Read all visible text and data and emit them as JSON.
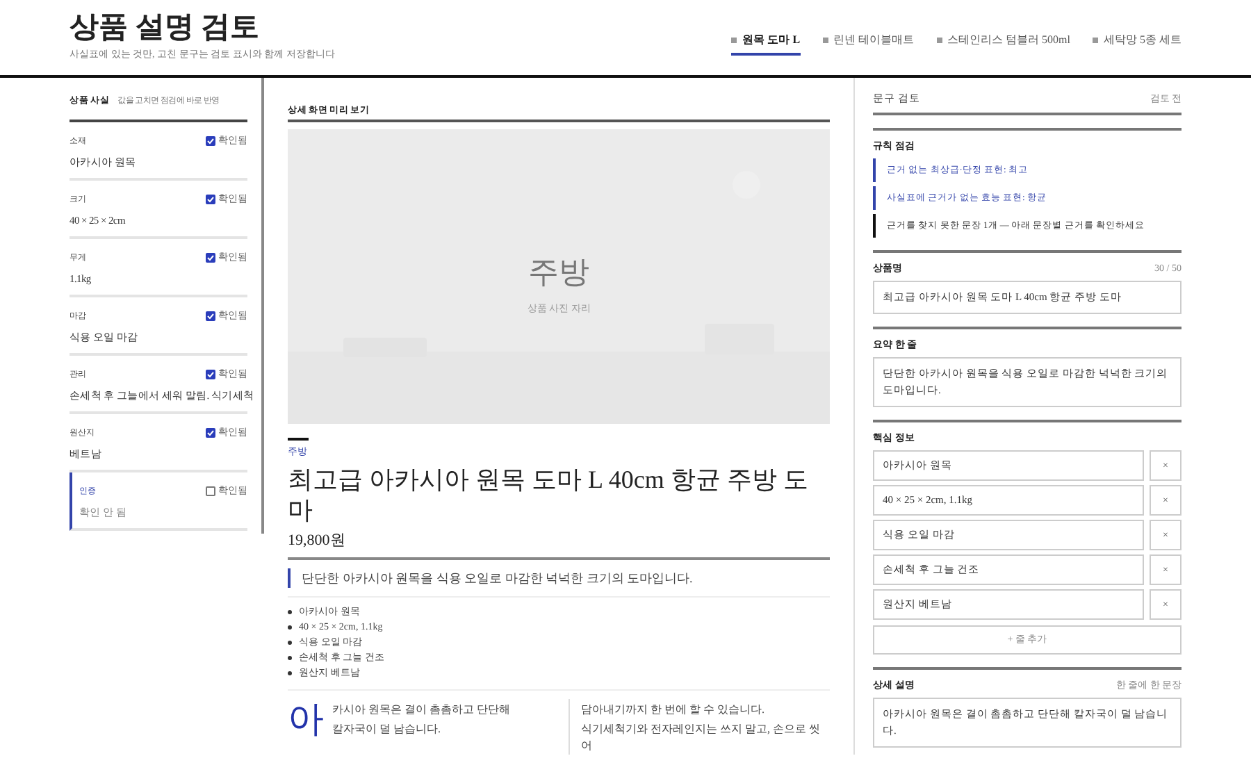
{
  "header": {
    "title": "상품 설명 검토",
    "subtitle": "사실표에 있는 것만, 고친 문구는 검토 표시와 함께 저장합니다"
  },
  "tabs": [
    {
      "label": "원목 도마 L",
      "selected": true
    },
    {
      "label": "린넨 테이블매트",
      "selected": false
    },
    {
      "label": "스테인리스 텀블러 500ml",
      "selected": false
    },
    {
      "label": "세탁망 5종 세트",
      "selected": false
    }
  ],
  "facts": {
    "title": "상품 사실",
    "hint": "값을 고치면 점검에 바로 반영",
    "fields": [
      {
        "label": "소재",
        "check_label": "확인됨",
        "checked": true,
        "value": "아카시아 원목"
      },
      {
        "label": "크기",
        "check_label": "확인됨",
        "checked": true,
        "value": "40 × 25 × 2cm"
      },
      {
        "label": "무게",
        "check_label": "확인됨",
        "checked": true,
        "value": "1.1kg"
      },
      {
        "label": "마감",
        "check_label": "확인됨",
        "checked": true,
        "value": "식용 오일 마감"
      },
      {
        "label": "관리",
        "check_label": "확인됨",
        "checked": true,
        "value": "손세척 후 그늘에서 세워 말림. 식기세척"
      },
      {
        "label": "원산지",
        "check_label": "확인됨",
        "checked": true,
        "value": "베트남"
      },
      {
        "label": "인증",
        "check_label": "확인됨",
        "checked": false,
        "value": "확인 안 됨"
      }
    ]
  },
  "preview": {
    "title": "상세 화면 미리 보기",
    "image_title": "주방",
    "image_caption": "상품 사진 자리",
    "category": "주방",
    "product_name": "최고급 아카시아 원목 도마 L 40cm 항균 주방 도마",
    "price": "19,800원",
    "summary": "단단한 아카시아 원목을 식용 오일로 마감한 넉넉한 크기의 도마입니다.",
    "bullets": [
      "아카시아 원목",
      "40 × 25 × 2cm, 1.1kg",
      "식용 오일 마감",
      "손세척 후 그늘 건조",
      "원산지 베트남"
    ],
    "drop_cap": "아",
    "column_1": [
      "카시아 원목은 결이 촘촘하고 단단해",
      "칼자국이 덜 남습니다."
    ],
    "column_2": [
      "담아내기까지 한 번에 할 수 있습니다.",
      "식기세척기와 전자레인지는 쓰지 말고, 손으로 씻어"
    ]
  },
  "review": {
    "title": "문구 검토",
    "status": "검토 전",
    "rules_title": "규칙 점검",
    "rules": [
      {
        "kind": "warning",
        "text": "근거 없는 최상급·단정 표현: 최고"
      },
      {
        "kind": "warning",
        "text": "사실표에 근거가 없는 효능 표현: 항균"
      },
      {
        "kind": "note",
        "text": "근거를 찾지 못한 문장 1개 — 아래 문장별 근거를 확인하세요"
      }
    ],
    "name_label": "상품명",
    "name_count": "30 / 50",
    "name_value": "최고급 아카시아 원목 도마 L 40cm 항균 주방 도마",
    "summary_label": "요약 한 줄",
    "summary_value": "단단한 아카시아 원목을 식용 오일로 마감한 넉넉한 크기의 도마입니다.",
    "key_label": "핵심 정보",
    "key_items": [
      "아카시아 원목",
      "40 × 25 × 2cm, 1.1kg",
      "식용 오일 마감",
      "손세척 후 그늘 건조",
      "원산지 베트남"
    ],
    "remove_glyph": "×",
    "add_button": "+ 줄 추가",
    "detail_label": "상세 설명",
    "detail_hint": "한 줄에 한 문장",
    "detail_value": "아카시아 원목은 결이 촘촘하고 단단해 칼자국이 덜 남습니다."
  }
}
